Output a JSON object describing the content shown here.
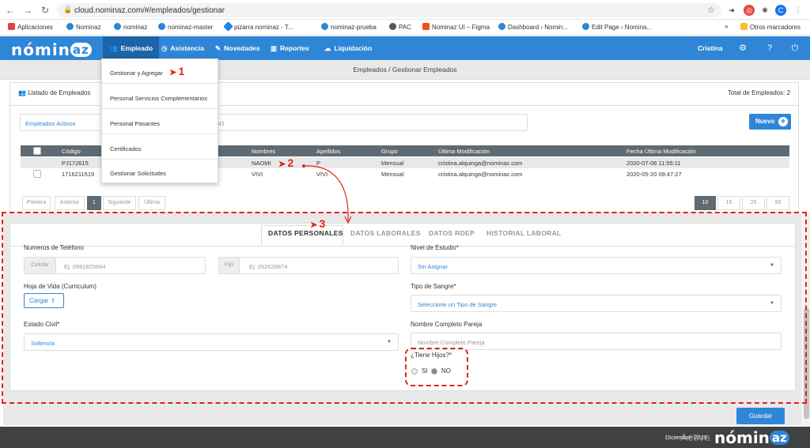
{
  "browser": {
    "url": "cloud.nominaz.com/#/empleados/gestionar",
    "profile_initial": "C"
  },
  "bookmarks": {
    "items": [
      "Aplicaciones",
      "Nominaz",
      "nominaz",
      "nominaz-master",
      "pizarra nominaz - T...",
      "nominaz-prueba",
      "PAC",
      "Nominaz UI – Figma",
      "Dashboard ‹ Nomin...",
      "Edit Page ‹ Nomina..."
    ],
    "more": "»",
    "other": "Otros marcadores"
  },
  "app": {
    "logo": "nominaz",
    "menu": [
      "Empleado",
      "Asistencia",
      "Novedades",
      "Reportes",
      "Liquidación"
    ],
    "user": "Cristina",
    "brand_color": "#2f86d6"
  },
  "breadcrumb": "Empleados / Gestionar Empleados",
  "list": {
    "title": "Listado de Empleados",
    "total": "Total de Empleados: 2",
    "filter_active": "Empleados Activos",
    "filter_search": "LEADO",
    "new_button": "Nuevo",
    "columns": [
      "Código",
      "Nombres",
      "Apellidos",
      "Grupo",
      "Última Modificación",
      "Fecha Última Modificación"
    ],
    "rows": [
      {
        "codigo": "PJ172615",
        "nombres": "NAOMI",
        "apellidos": "P",
        "grupo": "Mensual",
        "ultima": "cristina.alquinga@nominaz.com",
        "fecha": "2020-07-06 11:55:11"
      },
      {
        "codigo": "1716211519",
        "nombres": "VIVI",
        "apellidos": "VIVI",
        "grupo": "Mensual",
        "ultima": "cristina.alquinga@nominaz.com",
        "fecha": "2020-05-20 09:47:27"
      }
    ],
    "pagination": [
      "Primera",
      "Anterior",
      "1",
      "Siguiente",
      "Última"
    ],
    "page_sizes": [
      "10",
      "15",
      "25",
      "50"
    ]
  },
  "dropdown": {
    "items": [
      "Gestionar y Agregar",
      "Personal Servicios Complementarios",
      "Personal Pasantes",
      "Certificados",
      "Gestionar Solicitudes"
    ]
  },
  "annotations": {
    "one": "1",
    "two": "2",
    "three": "3",
    "color": "#e2231a"
  },
  "tabs": [
    "DATOS PERSONALES",
    "DATOS LABORALES",
    "DATOS RDEP",
    "HISTORIAL LABORAL"
  ],
  "form": {
    "phones_label": "Numeros de Teléfono",
    "celular_addon": "Celular",
    "celular_placeholder": "Ej: 0992825664",
    "fijo_addon": "Fijo",
    "fijo_placeholder": "Ej: 052628874",
    "cv_label": "Hoja de Vida (Curriculum)",
    "cargar": "Cargar",
    "estado_civil_label": "Estado Civil*",
    "estado_civil_value": "Soltero/a",
    "nivel_estudio_label": "Nivel de Estudio*",
    "nivel_estudio_value": "Sin Asignar",
    "tipo_sangre_label": "Tipo de Sangre*",
    "tipo_sangre_value": "Seleccione un Tipo de Sangre",
    "pareja_label": "Nombre Completo Pareja",
    "pareja_placeholder": "Nombre Completo Pareja",
    "hijos_label": "¿Tiene Hijos?*",
    "si": "SI",
    "no": "NO",
    "save": "Guardar"
  },
  "footer": {
    "date": "Diciembre-2019",
    "activa": "Activa",
    "logo": "nominaz"
  }
}
